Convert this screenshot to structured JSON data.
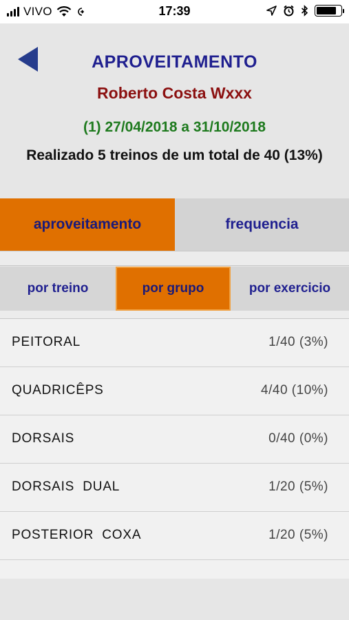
{
  "status_bar": {
    "carrier": "VIVO",
    "time": "17:39",
    "battery_level": 0.82
  },
  "header": {
    "title": "APROVEITAMENTO",
    "athlete_name": "Roberto Costa Wxxx",
    "period": "(1) 27/04/2018 a 31/10/2018",
    "summary": "Realizado 5 treinos de um total de 40 (13%)"
  },
  "main_tabs": [
    {
      "label": "aproveitamento",
      "active": true
    },
    {
      "label": "frequencia",
      "active": false
    }
  ],
  "sub_tabs": [
    {
      "label": "por treino",
      "active": false
    },
    {
      "label": "por grupo",
      "active": true
    },
    {
      "label": "por exercicio",
      "active": false
    }
  ],
  "groups": [
    {
      "name": "PEITORAL",
      "value": "1/40 (3%)"
    },
    {
      "name": "QUADRICÊPS",
      "value": "4/40 (10%)"
    },
    {
      "name": "DORSAIS",
      "value": "0/40 (0%)"
    },
    {
      "name": "DORSAIS  DUAL",
      "value": "1/20 (5%)"
    },
    {
      "name": "POSTERIOR  COXA",
      "value": "1/20 (5%)"
    }
  ],
  "colors": {
    "accent_orange": "#e07000",
    "title_blue": "#1f1f8f",
    "name_red": "#8b1010",
    "period_green": "#1e7a1e"
  },
  "icons": {
    "back": "back-arrow-icon"
  }
}
